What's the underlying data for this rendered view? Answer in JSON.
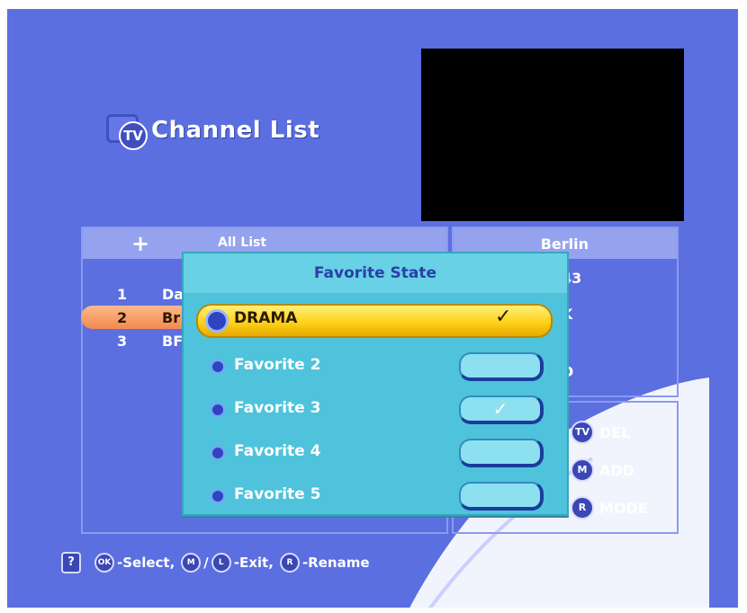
{
  "header": {
    "badge": "TV",
    "title": "Channel List"
  },
  "list": {
    "title": "All List",
    "plus_icon": "+",
    "rows": [
      {
        "num": "1",
        "name": "Da"
      },
      {
        "num": "2",
        "name": "Br"
      },
      {
        "num": "3",
        "name": "BF"
      }
    ]
  },
  "info": {
    "city": "Berlin",
    "line1": "43",
    "line2": "K",
    "line3": "D"
  },
  "keys": [
    {
      "btn": "TV",
      "label": "DEL"
    },
    {
      "btn": "M",
      "label": "ADD"
    },
    {
      "btn": "R",
      "label": "MODE"
    }
  ],
  "bottom": {
    "help": "?",
    "ok_btn": "OK",
    "select": "-Select,",
    "m_btn": "M",
    "slash": "/",
    "l_btn": "L",
    "exit": "-Exit,",
    "r_btn": "R",
    "rename": "-Rename"
  },
  "dialog": {
    "title": "Favorite State",
    "items": [
      {
        "label": "DRAMA",
        "check": "✓"
      },
      {
        "label": "Favorite 2",
        "check": ""
      },
      {
        "label": "Favorite 3",
        "check": "✓"
      },
      {
        "label": "Favorite 4",
        "check": ""
      },
      {
        "label": "Favorite 5",
        "check": ""
      }
    ]
  },
  "colors": {
    "background": "#5b6fe0",
    "dialog": "#4ec3db",
    "highlight": "#ffd21a",
    "selected_row": "#f28a4f"
  }
}
